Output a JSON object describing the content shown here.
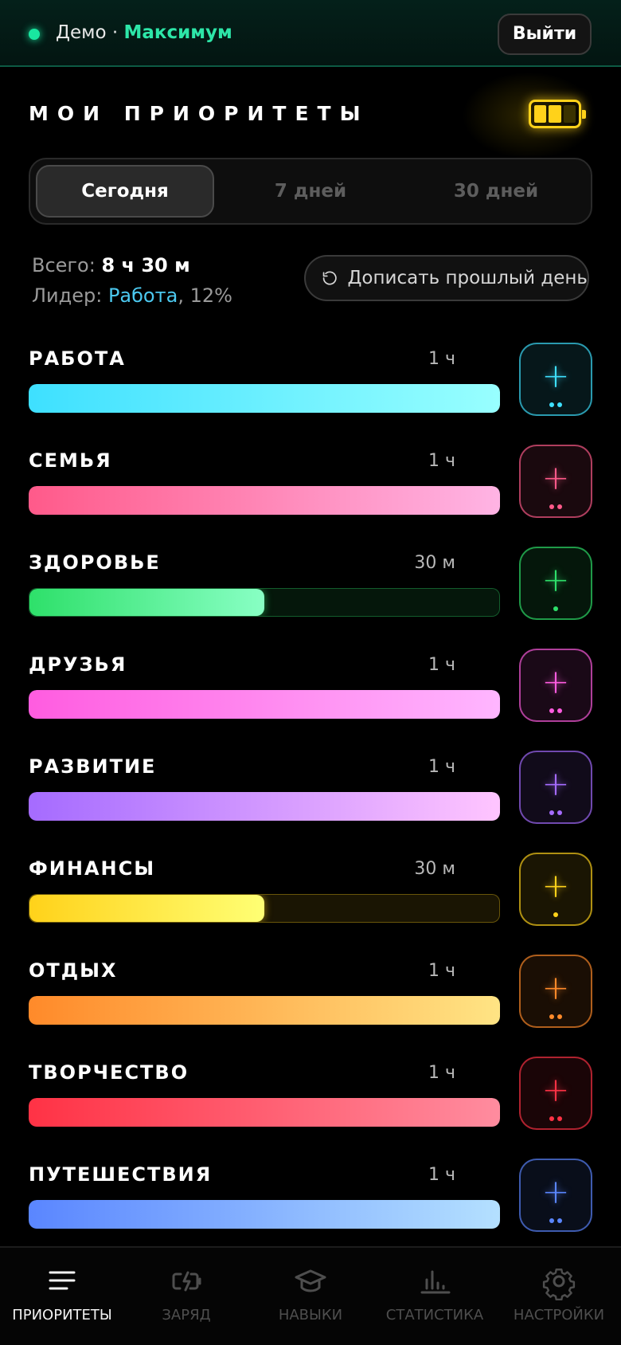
{
  "header": {
    "user_prefix": "Демо · ",
    "user_name": "Максимум",
    "logout_label": "Выйти"
  },
  "page": {
    "title": "МОИ ПРИОРИТЕТЫ",
    "battery_level": 0.67
  },
  "period_tabs": [
    {
      "label": "Сегодня",
      "active": true
    },
    {
      "label": "7 дней",
      "active": false
    },
    {
      "label": "30 дней",
      "active": false
    }
  ],
  "summary": {
    "total_label": "Всего: ",
    "total_value": "8 ч 30 м",
    "leader_label": "Лидер: ",
    "leader_name": "Работа",
    "leader_pct": ", 12%",
    "backfill_label": "Дописать прошлый день"
  },
  "categories": [
    {
      "name": "РАБОТА",
      "time": "1 ч",
      "fill": 1.0,
      "color": "#3ee0ff",
      "dots": 2
    },
    {
      "name": "СЕМЬЯ",
      "time": "1 ч",
      "fill": 1.0,
      "color": "#ff5a8a",
      "dots": 2
    },
    {
      "name": "ЗДОРОВЬЕ",
      "time": "30 м",
      "fill": 0.5,
      "color": "#2ee06a",
      "dots": 1
    },
    {
      "name": "ДРУЗЬЯ",
      "time": "1 ч",
      "fill": 1.0,
      "color": "#ff5ce0",
      "dots": 2
    },
    {
      "name": "РАЗВИТИЕ",
      "time": "1 ч",
      "fill": 1.0,
      "color": "#a56bff",
      "dots": 2
    },
    {
      "name": "ФИНАНСЫ",
      "time": "30 м",
      "fill": 0.5,
      "color": "#ffd21a",
      "dots": 1
    },
    {
      "name": "ОТДЫХ",
      "time": "1 ч",
      "fill": 1.0,
      "color": "#ff8a2a",
      "dots": 2
    },
    {
      "name": "ТВОРЧЕСТВО",
      "time": "1 ч",
      "fill": 1.0,
      "color": "#ff3245",
      "dots": 2
    },
    {
      "name": "ПУТЕШЕСТВИЯ",
      "time": "1 ч",
      "fill": 1.0,
      "color": "#5a86ff",
      "dots": 2
    }
  ],
  "add_button_symbol": "+",
  "nav": [
    {
      "label": "ПРИОРИТЕТЫ",
      "icon": "list-icon",
      "active": true
    },
    {
      "label": "ЗАРЯД",
      "icon": "battery-charge-icon",
      "active": false
    },
    {
      "label": "НАВЫКИ",
      "icon": "graduation-cap-icon",
      "active": false
    },
    {
      "label": "СТАТИСТИКА",
      "icon": "bar-chart-icon",
      "active": false
    },
    {
      "label": "НАСТРОЙКИ",
      "icon": "gear-icon",
      "active": false
    }
  ]
}
